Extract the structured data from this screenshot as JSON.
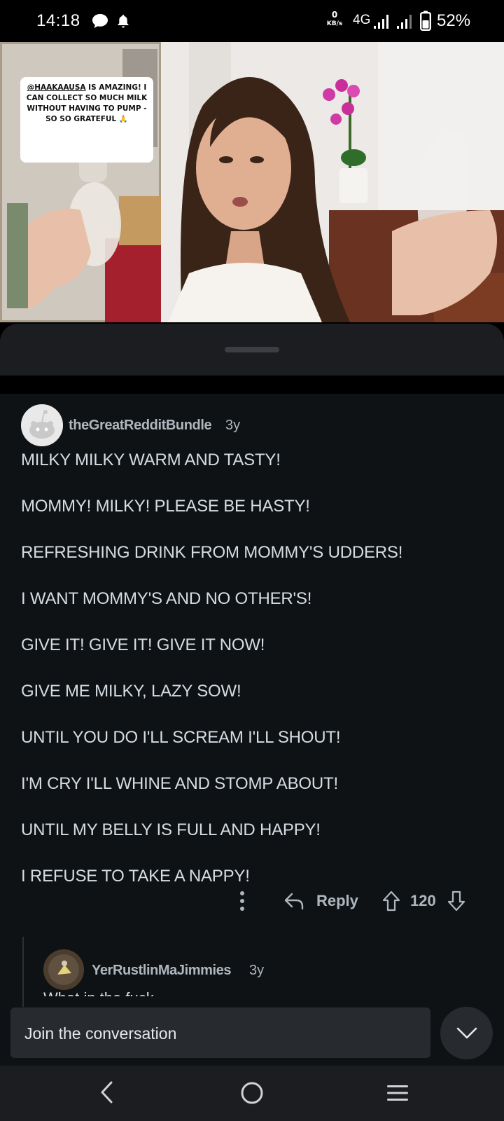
{
  "status_bar": {
    "time": "14:18",
    "net_speed_value": "0",
    "net_speed_unit": "KB/s",
    "network": "4G",
    "battery_percent": "52%",
    "icons": [
      "chat-icon",
      "bell-icon",
      "signal-icon",
      "signal-icon",
      "battery-icon"
    ]
  },
  "media": {
    "caption_handle": "@HAAKAAUSA",
    "caption_rest": " IS AMAZING! I CAN COLLECT SO MUCH MILK WITHOUT HAVING TO PUMP - SO SO GRATEFUL 🙏"
  },
  "comment": {
    "author": "theGreatRedditBundle",
    "age": "3y",
    "lines": [
      "MILKY MILKY WARM AND TASTY!",
      "MOMMY! MILKY! PLEASE BE HASTY!",
      "REFRESHING DRINK FROM MOMMY'S UDDERS!",
      "I WANT MOMMY'S AND NO OTHER'S!",
      "GIVE IT! GIVE IT! GIVE IT NOW!",
      "GIVE ME MILKY, LAZY SOW!",
      "UNTIL YOU DO I'LL SCREAM I'LL SHOUT!",
      "I'M CRY I'LL WHINE AND STOMP ABOUT!",
      "UNTIL MY BELLY IS FULL AND HAPPY!",
      "I REFUSE TO TAKE A NAPPY!"
    ],
    "actions": {
      "reply_label": "Reply",
      "score": "120"
    }
  },
  "reply": {
    "author": "YerRustlinMaJimmies",
    "age": "3y",
    "preview": "What in the fuck"
  },
  "composer": {
    "placeholder": "Join the conversation"
  },
  "colors": {
    "background": "#0f1215",
    "sheet": "#1b1d20",
    "meta_text": "#aeb7be",
    "body_text": "#d5dde3"
  }
}
